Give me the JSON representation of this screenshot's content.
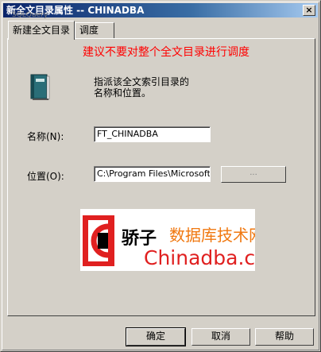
{
  "window": {
    "title": "新全文目录属性 -- CHINADBA",
    "title_ghost": "SQLQuery",
    "close_label": "×"
  },
  "tabs": [
    {
      "label": "新建全文目录",
      "active": true
    },
    {
      "label": "调度",
      "active": false
    }
  ],
  "panel": {
    "warning": "建议不要对整个全文目录进行调度",
    "description_line1": "指派该全文索引目录的",
    "description_line2": "名称和位置。",
    "name_label": "名称(N):",
    "name_value": "FT_CHINADBA",
    "location_label": "位置(O):",
    "location_value": "C:\\Program Files\\Microsoft SQ",
    "browse_label": "..."
  },
  "logo": {
    "cn_name": "骄子",
    "slogan": "数据库技术网",
    "brand": "Chinadba.cn",
    "colors": {
      "red": "#e02020",
      "orange": "#f07810",
      "black": "#000000"
    }
  },
  "buttons": {
    "ok": "确定",
    "cancel": "取消",
    "help": "帮助"
  },
  "icons": [
    "close-icon",
    "catalog-book-icon"
  ]
}
